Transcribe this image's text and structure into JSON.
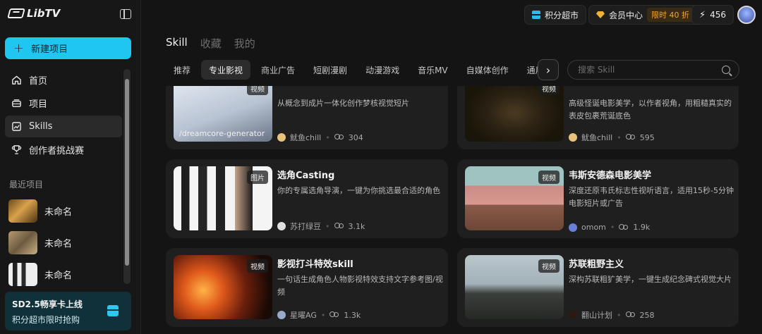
{
  "sidebar": {
    "logo": "LibTV",
    "new_project": "新建项目",
    "nav": [
      {
        "label": "首页"
      },
      {
        "label": "项目"
      },
      {
        "label": "Skills"
      },
      {
        "label": "创作者挑战赛"
      }
    ],
    "recent_title": "最近项目",
    "recent": [
      {
        "label": "未命名"
      },
      {
        "label": "未命名"
      },
      {
        "label": "未命名"
      }
    ],
    "promo": {
      "title": "SD2.5畅享卡上线",
      "subtitle": "积分超市限时抢购"
    }
  },
  "topbar": {
    "store": "积分超市",
    "vip": "会员中心",
    "vip_tag": "限时 40 折",
    "credits": "456"
  },
  "main": {
    "tabs": [
      {
        "label": "Skill"
      },
      {
        "label": "收藏"
      },
      {
        "label": "我的"
      }
    ],
    "categories": [
      {
        "label": "推荐"
      },
      {
        "label": "专业影视"
      },
      {
        "label": "商业广告"
      },
      {
        "label": "短剧漫剧"
      },
      {
        "label": "动漫游戏"
      },
      {
        "label": "音乐MV"
      },
      {
        "label": "自媒体创作"
      },
      {
        "label": "通用"
      }
    ],
    "search_placeholder": "搜索 Skill",
    "cards": [
      {
        "title": "",
        "badge": "视频",
        "caption": "/dreamcore-generator",
        "desc": "从概念到成片一体化创作梦核视觉短片",
        "author": "鱿鱼chill",
        "count": "304"
      },
      {
        "title": "",
        "badge": "视频",
        "caption": "",
        "desc": "高级怪诞电影美学，以作者视角，用粗糙真实的表皮包裹荒诞底色",
        "author": "鱿鱼chill",
        "count": "595"
      },
      {
        "title": "选角Casting",
        "badge": "图片",
        "caption": "",
        "desc": "你的专属选角导演，一键为你挑选最合适的角色",
        "author": "苏打绿豆",
        "count": "3.1k"
      },
      {
        "title": "韦斯安德森电影美学",
        "badge": "视频",
        "caption": "",
        "desc": "深度还原韦氏标志性视听语言，适用15秒-5分钟电影短片或广告",
        "author": "omom",
        "count": "1.9k"
      },
      {
        "title": "影视打斗特效skill",
        "badge": "视频",
        "caption": "",
        "desc": "一句话生成角色人物影视特效支持文字参考图/视频",
        "author": "星曜AG",
        "count": "1.3k"
      },
      {
        "title": "苏联粗野主义",
        "badge": "视频",
        "caption": "",
        "desc": "深构苏联粗犷美学，一键生成纪念碑式视觉大片",
        "author": "翻山计划",
        "count": "258"
      }
    ]
  },
  "colors": {
    "accent": "#1fc6f0",
    "background": "#141414",
    "card": "#1f1f1f",
    "vip": "#f0a53a"
  }
}
